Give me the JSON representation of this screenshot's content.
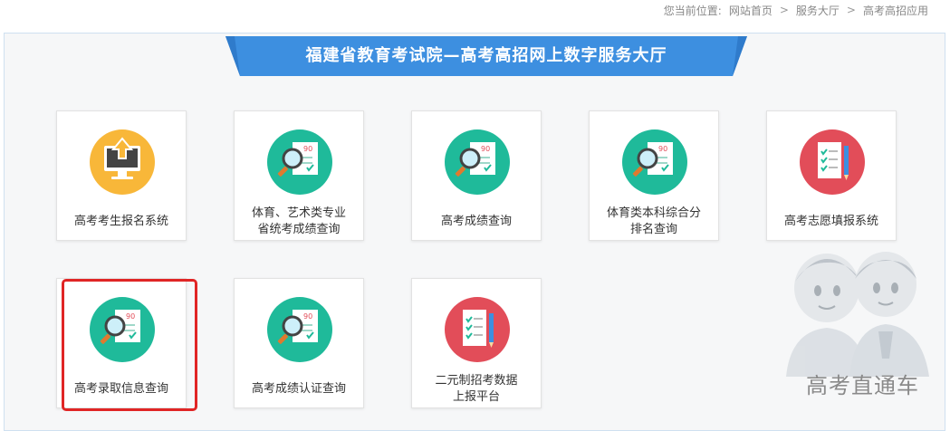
{
  "breadcrumb": {
    "prefix": "您当前位置:",
    "items": [
      "网站首页",
      "服务大厅",
      "高考高招应用"
    ],
    "separator": ">"
  },
  "banner": {
    "title": "福建省教育考试院—高考高招网上数字服务大厅"
  },
  "tiles": [
    {
      "label": "高考考生报名系统",
      "icon": "computer-upload-icon",
      "color": "#f8b739"
    },
    {
      "label": "体育、艺术类专业\n省统考成绩查询",
      "icon": "magnifier-report-icon",
      "color": "#1fba9a"
    },
    {
      "label": "高考成绩查询",
      "icon": "magnifier-report-icon",
      "color": "#1fba9a"
    },
    {
      "label": "体育类本科综合分\n排名查询",
      "icon": "magnifier-report-icon",
      "color": "#1fba9a"
    },
    {
      "label": "高考志愿填报系统",
      "icon": "checklist-pen-icon",
      "color": "#e24d59"
    },
    {
      "label": "高考录取信息查询",
      "icon": "magnifier-report-icon",
      "color": "#1fba9a"
    },
    {
      "label": "高考成绩认证查询",
      "icon": "magnifier-report-icon",
      "color": "#1fba9a"
    },
    {
      "label": "二元制招考数据\n上报平台",
      "icon": "checklist-pen-icon",
      "color": "#e24d59"
    }
  ],
  "mascot": {
    "text": "高考直通车"
  },
  "icon_glyph": {
    "score": "90"
  },
  "colors": {
    "banner": "#3d8fe0",
    "highlight": "#e02525"
  }
}
